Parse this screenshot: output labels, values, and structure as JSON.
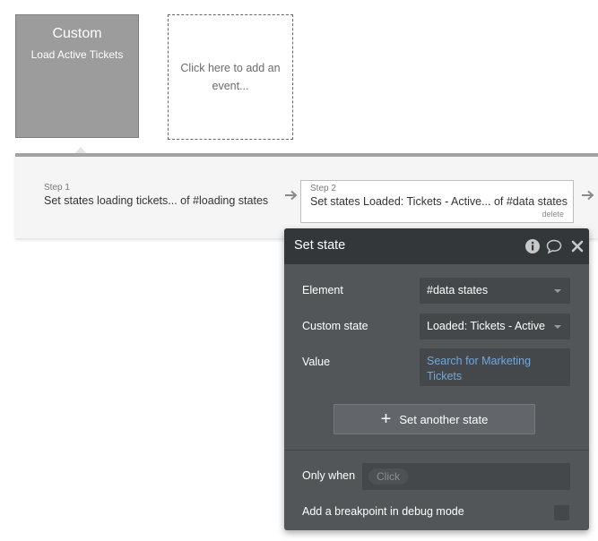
{
  "event": {
    "title": "Custom",
    "subtitle": "Load Active Tickets",
    "add_event_text": "Click here to add an event..."
  },
  "steps": [
    {
      "number": "Step 1",
      "text": "Set states loading tickets... of #loading states"
    },
    {
      "number": "Step 2",
      "text": "Set states Loaded: Tickets - Active... of #data states",
      "delete_label": "delete"
    }
  ],
  "panel": {
    "title": "Set state",
    "icons": [
      "info-icon",
      "comment-icon",
      "close-icon"
    ],
    "element_label": "Element",
    "element_value": "#data states",
    "custom_state_label": "Custom state",
    "custom_state_value": "Loaded: Tickets - Active",
    "value_label": "Value",
    "value_text": "Search for Marketing Tickets",
    "add_state_button": "Set another state",
    "only_when_label": "Only when",
    "only_when_placeholder": "Click",
    "breakpoint_label": "Add a breakpoint in debug mode",
    "breakpoint_checked": false
  },
  "colors": {
    "panel_bg": "#535659",
    "panel_header": "#33373a",
    "field_bg": "#45484b",
    "value_link": "#6ea8e0",
    "event_card": "#9c9c9c"
  }
}
